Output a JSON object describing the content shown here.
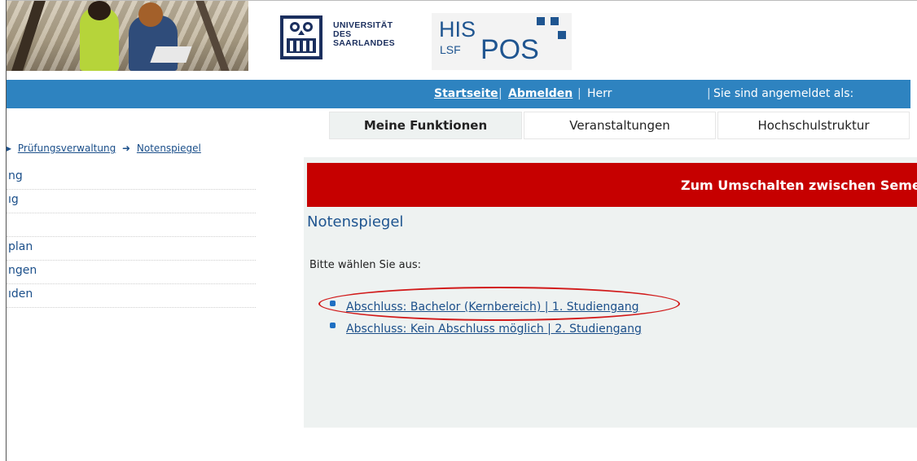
{
  "header": {
    "university_lines": [
      "UNIVERSITÄT",
      "DES",
      "SAARLANDES"
    ],
    "his_label": "HIS",
    "lsf_label": "LSF",
    "pos_label": "POS"
  },
  "topnav": {
    "startseite": "Startseite",
    "separator": "|",
    "abmelden": "Abmelden",
    "user_prefix": "Herr",
    "login_status": "Sie sind angemeldet als:"
  },
  "tabs": [
    {
      "label": "Meine Funktionen",
      "active": true
    },
    {
      "label": "Veranstaltungen",
      "active": false
    },
    {
      "label": "Hochschulstruktur",
      "active": false
    }
  ],
  "breadcrumb": {
    "items": [
      "Prüfungsverwaltung",
      "Notenspiegel"
    ],
    "arrow": "➜"
  },
  "sidebar": {
    "items": [
      {
        "label": "ng"
      },
      {
        "label": "ıg"
      },
      {
        "label": ""
      },
      {
        "label": "plan"
      },
      {
        "label": "ngen"
      },
      {
        "label": "ıden"
      }
    ]
  },
  "banner": {
    "text": "Zum Umschalten zwischen Semest",
    "color": "#c60000"
  },
  "main": {
    "title": "Notenspiegel",
    "prompt": "Bitte wählen Sie aus:",
    "options": [
      {
        "label": "Abschluss: Bachelor (Kernbereich) | 1. Studiengang",
        "highlighted": true
      },
      {
        "label": "Abschluss: Kein Abschluss möglich | 2. Studiengang",
        "highlighted": false
      }
    ]
  },
  "colors": {
    "nav_blue": "#2e83c0",
    "brand_blue": "#1f5590",
    "highlight_red": "#d11a1a",
    "panel_bg": "#eef2f1"
  }
}
